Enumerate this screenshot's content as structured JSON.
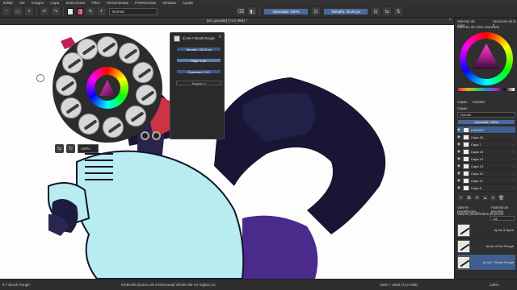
{
  "menu": [
    "Editar",
    "Ver",
    "Imagen",
    "Capa",
    "Seleccionar",
    "Filtro",
    "Herramientas",
    "Preferencias",
    "Ventana",
    "Ayuda"
  ],
  "toolbar": {
    "blend_mode": "Normal",
    "opacity_label": "Opacidad: 100%",
    "size_label": "Tamaño: 25,00 px"
  },
  "document_tab": {
    "title": "[sin guardar] (74,0 MiB) *"
  },
  "palette": {
    "zoom_label": "100%"
  },
  "brush_popup": {
    "preset_name": "d) Ink-7 Brush Rough",
    "size": "Tamaño: 25,00 px",
    "flow": "Flujo: 1,00",
    "opacity": "Opacidad: 1,00",
    "angle": "Ángulo: 0"
  },
  "docker": {
    "color_header_a": "Selector de color",
    "color_header_b": "Opciones de la h",
    "color_sub": "Selector de color avanzado",
    "tabs": [
      "Capas",
      "Canales"
    ],
    "layers_header": "Capas",
    "blend_mode": "Normal",
    "opacity_label": "Opacidad: 100%",
    "layers": [
      {
        "name": "LINEART",
        "selected": true
      },
      {
        "name": "Capa 16",
        "selected": false
      },
      {
        "name": "Capa 7",
        "selected": false
      },
      {
        "name": "Capa 15",
        "selected": false
      },
      {
        "name": "Capa 10",
        "selected": false
      },
      {
        "name": "Capa 13",
        "selected": false
      },
      {
        "name": "Capa 14",
        "selected": false
      },
      {
        "name": "Capa 11",
        "selected": false
      },
      {
        "name": "Capa 8",
        "selected": false
      }
    ],
    "presets_title_a": "Valores predefinidos...",
    "presets_title_b": "Historial de pinceles",
    "presets_sub": "Valores predefinidos de pincel",
    "presets_tag": "All",
    "presets": [
      {
        "name": "d) Ink-3 Gpen",
        "selected": false
      },
      {
        "name": "d) Ink-4 Pen Rough",
        "selected": false
      },
      {
        "name": "d) Ink-7 Brush Rough",
        "selected": true
      }
    ]
  },
  "status": {
    "brush": "k-7 Brush Rough",
    "color_profile": "RGB/Alfa (Entero de 8 bits/canal)  sRGB-elle-V2-srgbtrc.icc",
    "doc_size": "1500 × 1500 (74,0 MiB)",
    "zoom": "126%"
  },
  "colors": {
    "accent": "#4a6a9a",
    "ui_dark": "#2f2f2f",
    "character_shirt": "#b7ecf0",
    "character_pants": "#181634",
    "character_purple": "#4a2a8a"
  }
}
